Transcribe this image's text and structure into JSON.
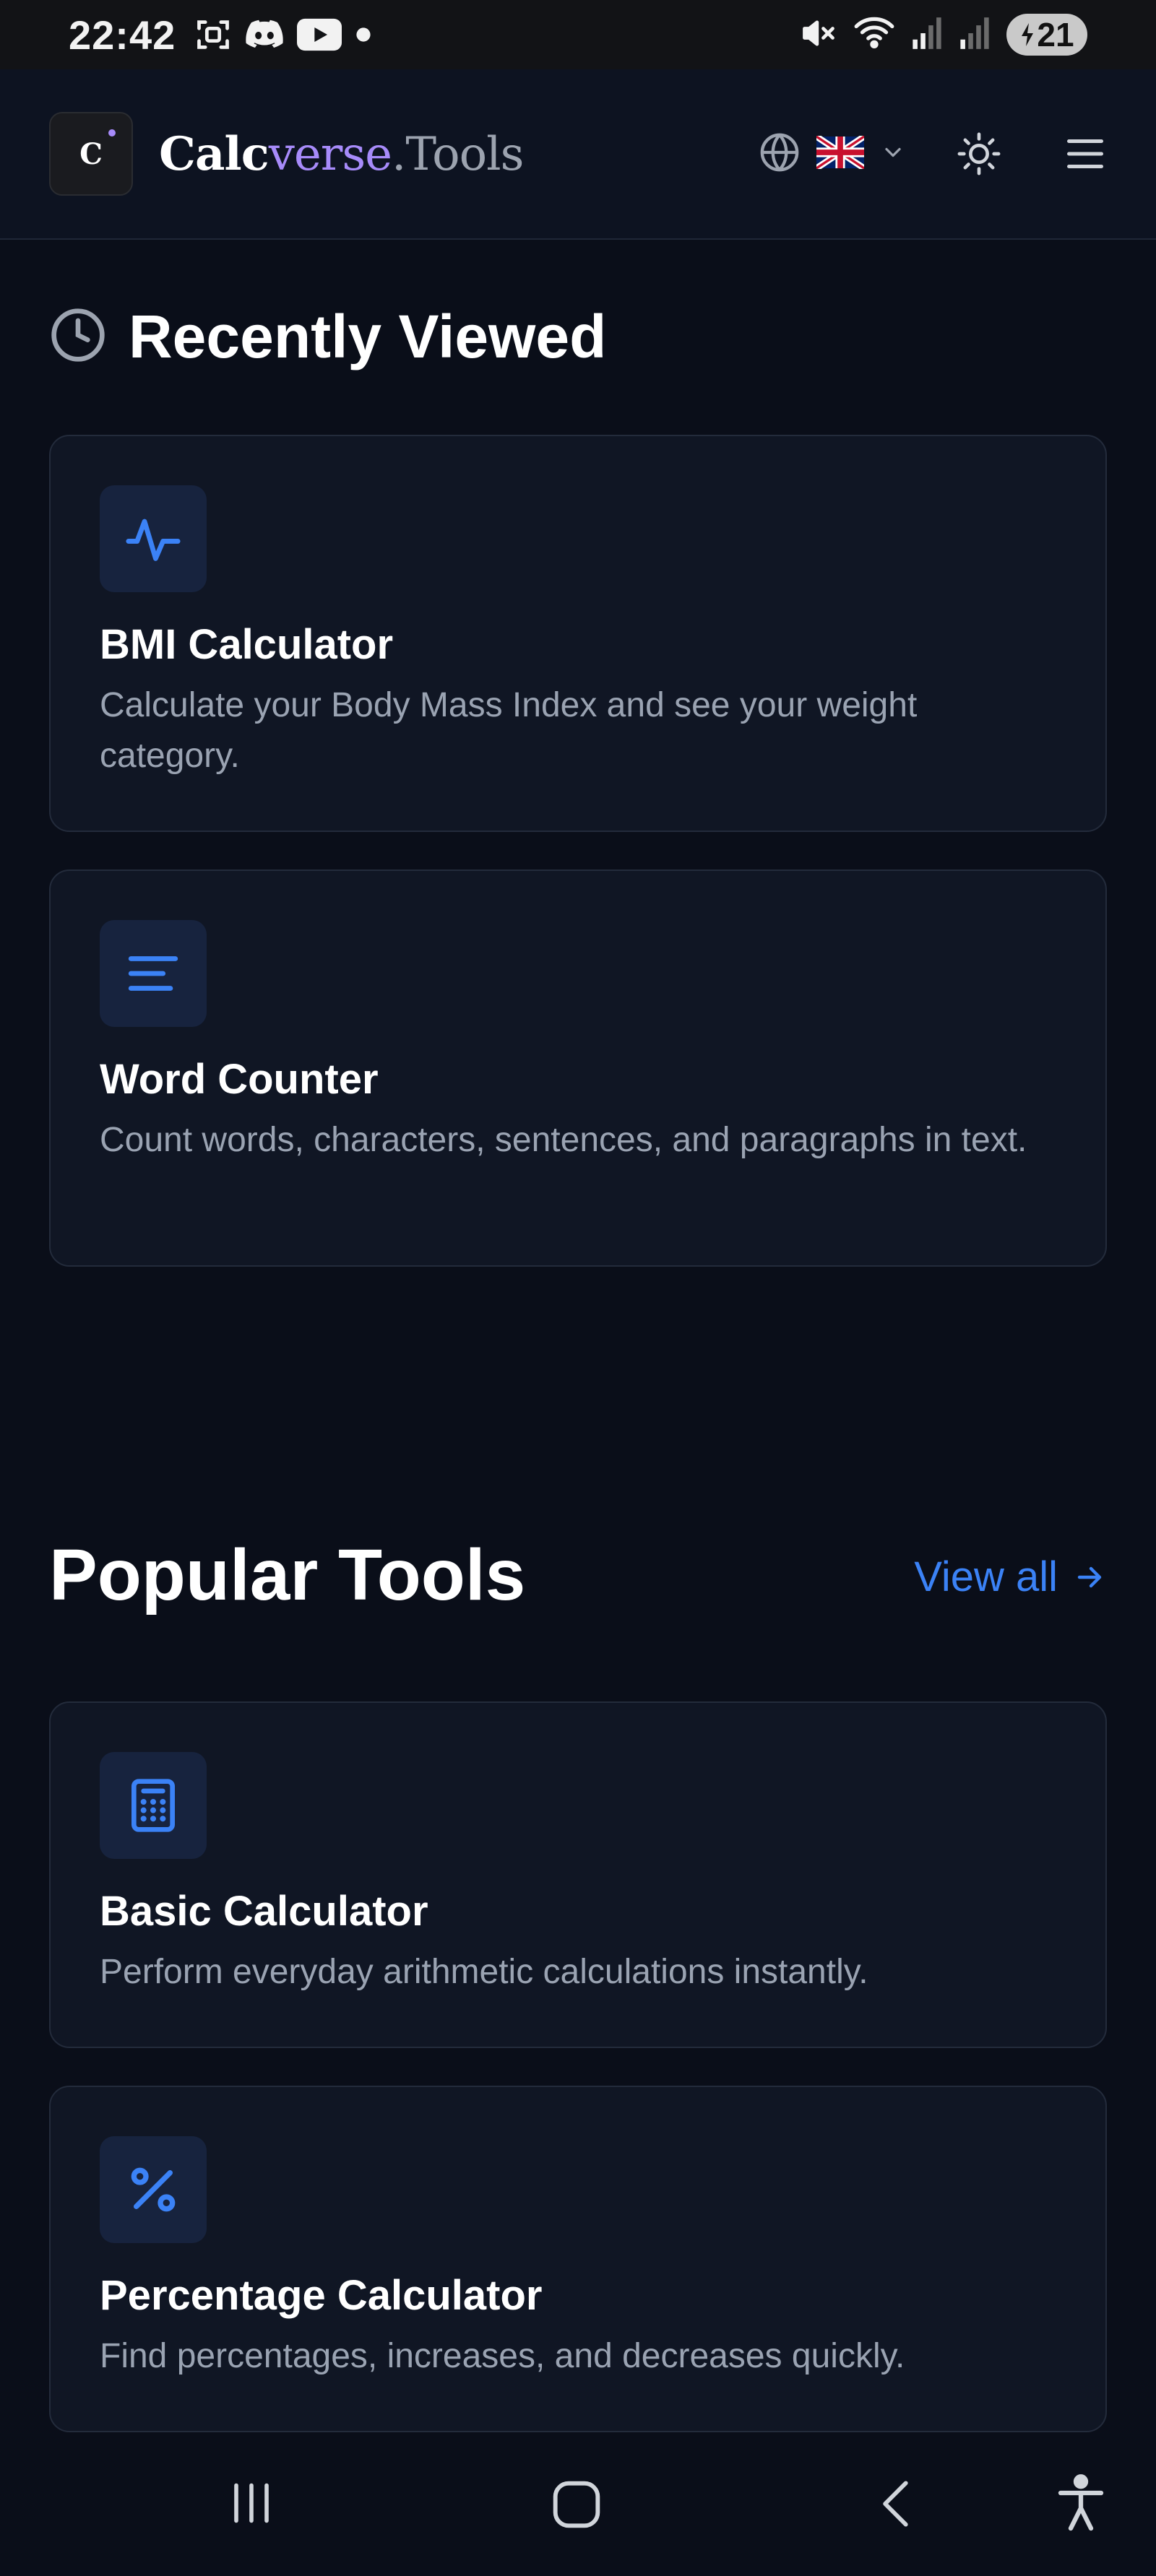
{
  "status_bar": {
    "time": "22:42",
    "battery": "21",
    "icons": [
      "screen-capture-icon",
      "discord-icon",
      "youtube-icon",
      "dot-icon",
      "mute-icon",
      "wifi-icon",
      "signal-icon",
      "signal-icon",
      "battery-icon"
    ]
  },
  "header": {
    "logo_letter": "C",
    "brand": {
      "part1": "Calc",
      "part2": "verse",
      "part3": ".Tools"
    },
    "icons": [
      "globe-icon",
      "uk-flag-icon",
      "chevron-down-icon",
      "sun-icon",
      "hamburger-menu-icon"
    ]
  },
  "recently_viewed": {
    "title": "Recently Viewed",
    "icon": "clock-icon",
    "items": [
      {
        "title": "BMI Calculator",
        "description": "Calculate your Body Mass Index and see your weight category.",
        "icon": "activity-icon"
      },
      {
        "title": "Word Counter",
        "description": "Count words, characters, sentences, and paragraphs in text.",
        "icon": "text-lines-icon"
      }
    ]
  },
  "popular_tools": {
    "title": "Popular Tools",
    "view_all": "View all",
    "items": [
      {
        "title": "Basic Calculator",
        "description": "Perform everyday arithmetic calculations instantly.",
        "icon": "calculator-icon"
      },
      {
        "title": "Percentage Calculator",
        "description": "Find percentages, increases, and decreases quickly.",
        "icon": "percent-icon"
      }
    ]
  },
  "colors": {
    "background": "#0a0e19",
    "card": "#101624",
    "accent": "#3b82f6",
    "brand_purple": "#a78bfa",
    "muted_text": "#9aa3b2"
  },
  "nav_bar": {
    "icons": [
      "recent-apps-icon",
      "home-icon",
      "back-icon",
      "accessibility-icon"
    ]
  }
}
